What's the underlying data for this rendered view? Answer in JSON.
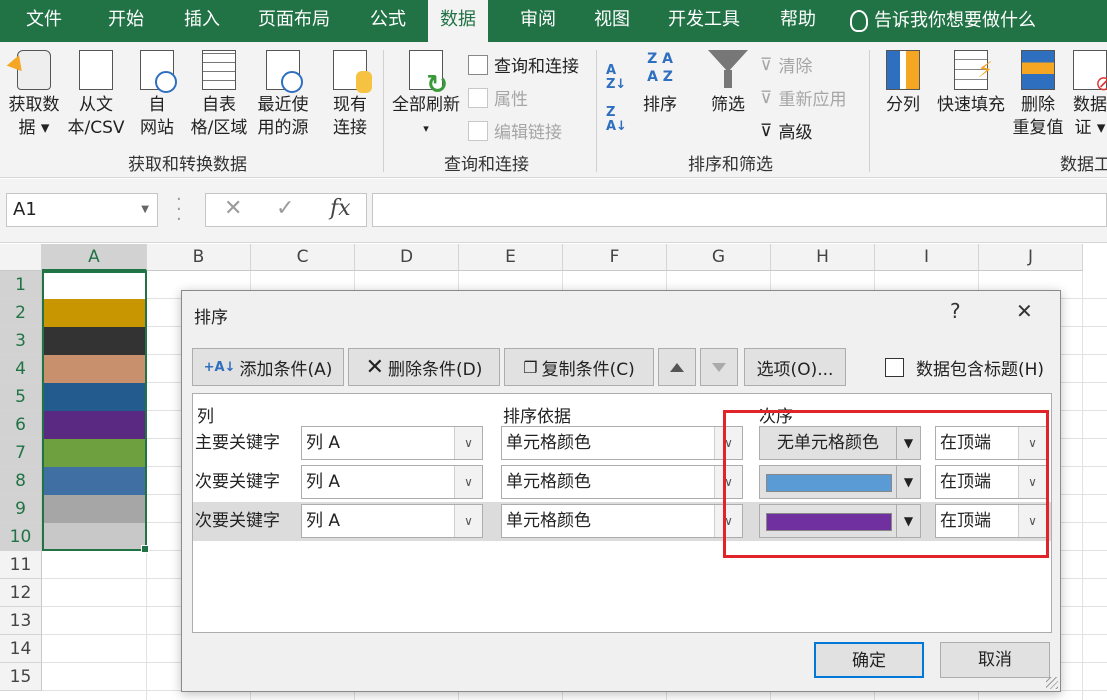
{
  "tabs": [
    "文件",
    "开始",
    "插入",
    "页面布局",
    "公式",
    "数据",
    "审阅",
    "视图",
    "开发工具",
    "帮助"
  ],
  "tell_me": "告诉我你想要做什么",
  "ribbon": {
    "get_data": [
      "获取数",
      "据 ▾"
    ],
    "from_text": [
      "从文",
      "本/CSV"
    ],
    "from_web": [
      "自",
      "网站"
    ],
    "from_table": [
      "自表",
      "格/区域"
    ],
    "recent": [
      "最近使",
      "用的源"
    ],
    "existing": [
      "现有",
      "连接"
    ],
    "group1": "获取和转换数据",
    "refresh_all": [
      "全部刷新",
      "▾"
    ],
    "queries_conn": "查询和连接",
    "properties": "属性",
    "edit_links": "编辑链接",
    "group2": "查询和连接",
    "sort": "排序",
    "filter": "筛选",
    "clear": "清除",
    "reapply": "重新应用",
    "advanced": "高级",
    "group3": "排序和筛选",
    "text_to_cols": "分列",
    "flash_fill": "快速填充",
    "remove_dup": [
      "删除",
      "重复值"
    ],
    "data_valid": [
      "数据",
      "证 ▾"
    ],
    "group4": "数据工"
  },
  "formula_bar": {
    "name_box": "A1",
    "fx": "fx",
    "cancel": "✕",
    "enter": "✓",
    "formula": ""
  },
  "sheet": {
    "columns": [
      "A",
      "B",
      "C",
      "D",
      "E",
      "F",
      "G",
      "H",
      "I",
      "J"
    ],
    "rows": [
      "1",
      "2",
      "3",
      "4",
      "5",
      "6",
      "7",
      "8",
      "9",
      "10",
      "11",
      "12",
      "13",
      "14",
      "15"
    ],
    "cell_colors": [
      "#ffffff",
      "#c89600",
      "#333333",
      "#c8906c",
      "#245b8e",
      "#5a2a82",
      "#6fa040",
      "#3f6fa3",
      "#a6a6a6",
      "#c8c8c8"
    ]
  },
  "dialog": {
    "title": "排序",
    "help": "?",
    "close": "✕",
    "add": "添加条件(A)",
    "delete": "删除条件(D)",
    "copy": "复制条件(C)",
    "options": "选项(O)...",
    "has_header": "数据包含标题(H)",
    "col_header": "列",
    "basis_header": "排序依据",
    "order_header": "次序",
    "rows": [
      {
        "label": "主要关键字",
        "column": "列 A",
        "basis": "单元格颜色",
        "order_text": "无单元格颜色",
        "position": "在顶端"
      },
      {
        "label": "次要关键字",
        "column": "列 A",
        "basis": "单元格颜色",
        "order_color": "#5b9bd5",
        "position": "在顶端"
      },
      {
        "label": "次要关键字",
        "column": "列 A",
        "basis": "单元格颜色",
        "order_color": "#7030a0",
        "position": "在顶端"
      }
    ],
    "ok": "确定",
    "cancel": "取消"
  }
}
